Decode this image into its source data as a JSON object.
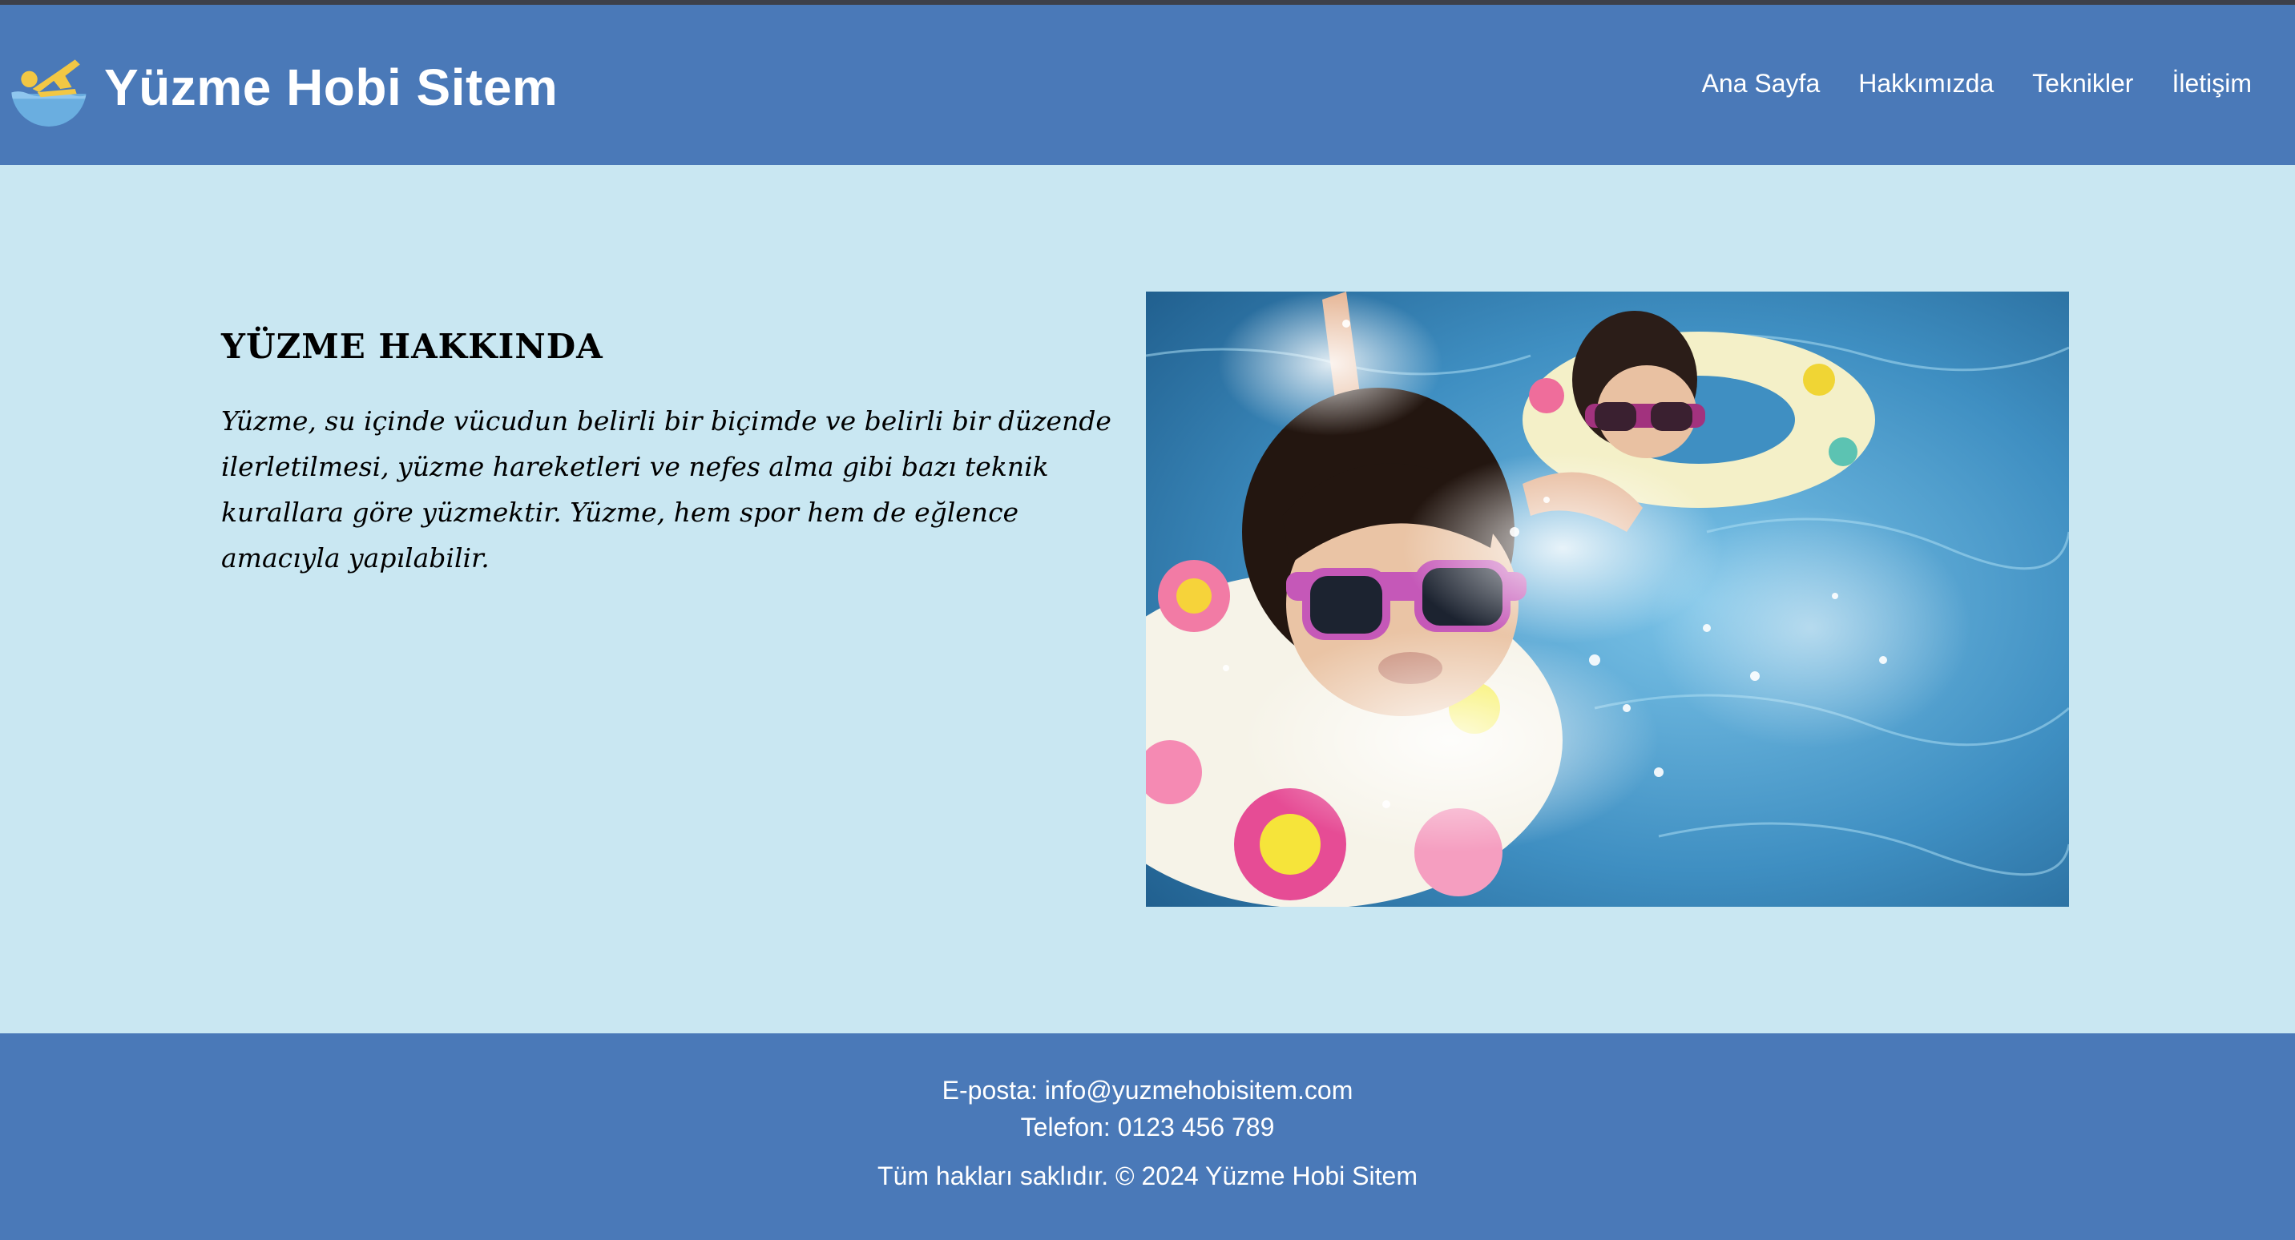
{
  "header": {
    "site_title": "Yüzme Hobi Sitem",
    "logo_icon": "swimmer-icon",
    "nav": [
      {
        "label": "Ana Sayfa"
      },
      {
        "label": "Hakkımızda"
      },
      {
        "label": "Teknikler"
      },
      {
        "label": "İletişim"
      }
    ]
  },
  "main": {
    "heading": "Yüzme Hakkında",
    "paragraph": "Yüzme, su içinde vücudun belirli bir biçimde ve belirli bir düzende ilerletilmesi, yüzme hareketleri ve nefes alma gibi bazı teknik kurallara göre yüzmektir. Yüzme, hem spor hem de eğlence amacıyla yapılabilir.",
    "image": "children-swimming-pool-photo"
  },
  "footer": {
    "email": "E-posta: info@yuzmehobisitem.com",
    "phone": "Telefon: 0123 456 789",
    "copyright": "Tüm hakları saklıdır. © 2024 Yüzme Hobi Sitem"
  },
  "colors": {
    "header_bg": "#4a79b8",
    "page_bg": "#c9e7f2",
    "footer_bg": "#4a79b8",
    "text_light": "#ffffff"
  }
}
